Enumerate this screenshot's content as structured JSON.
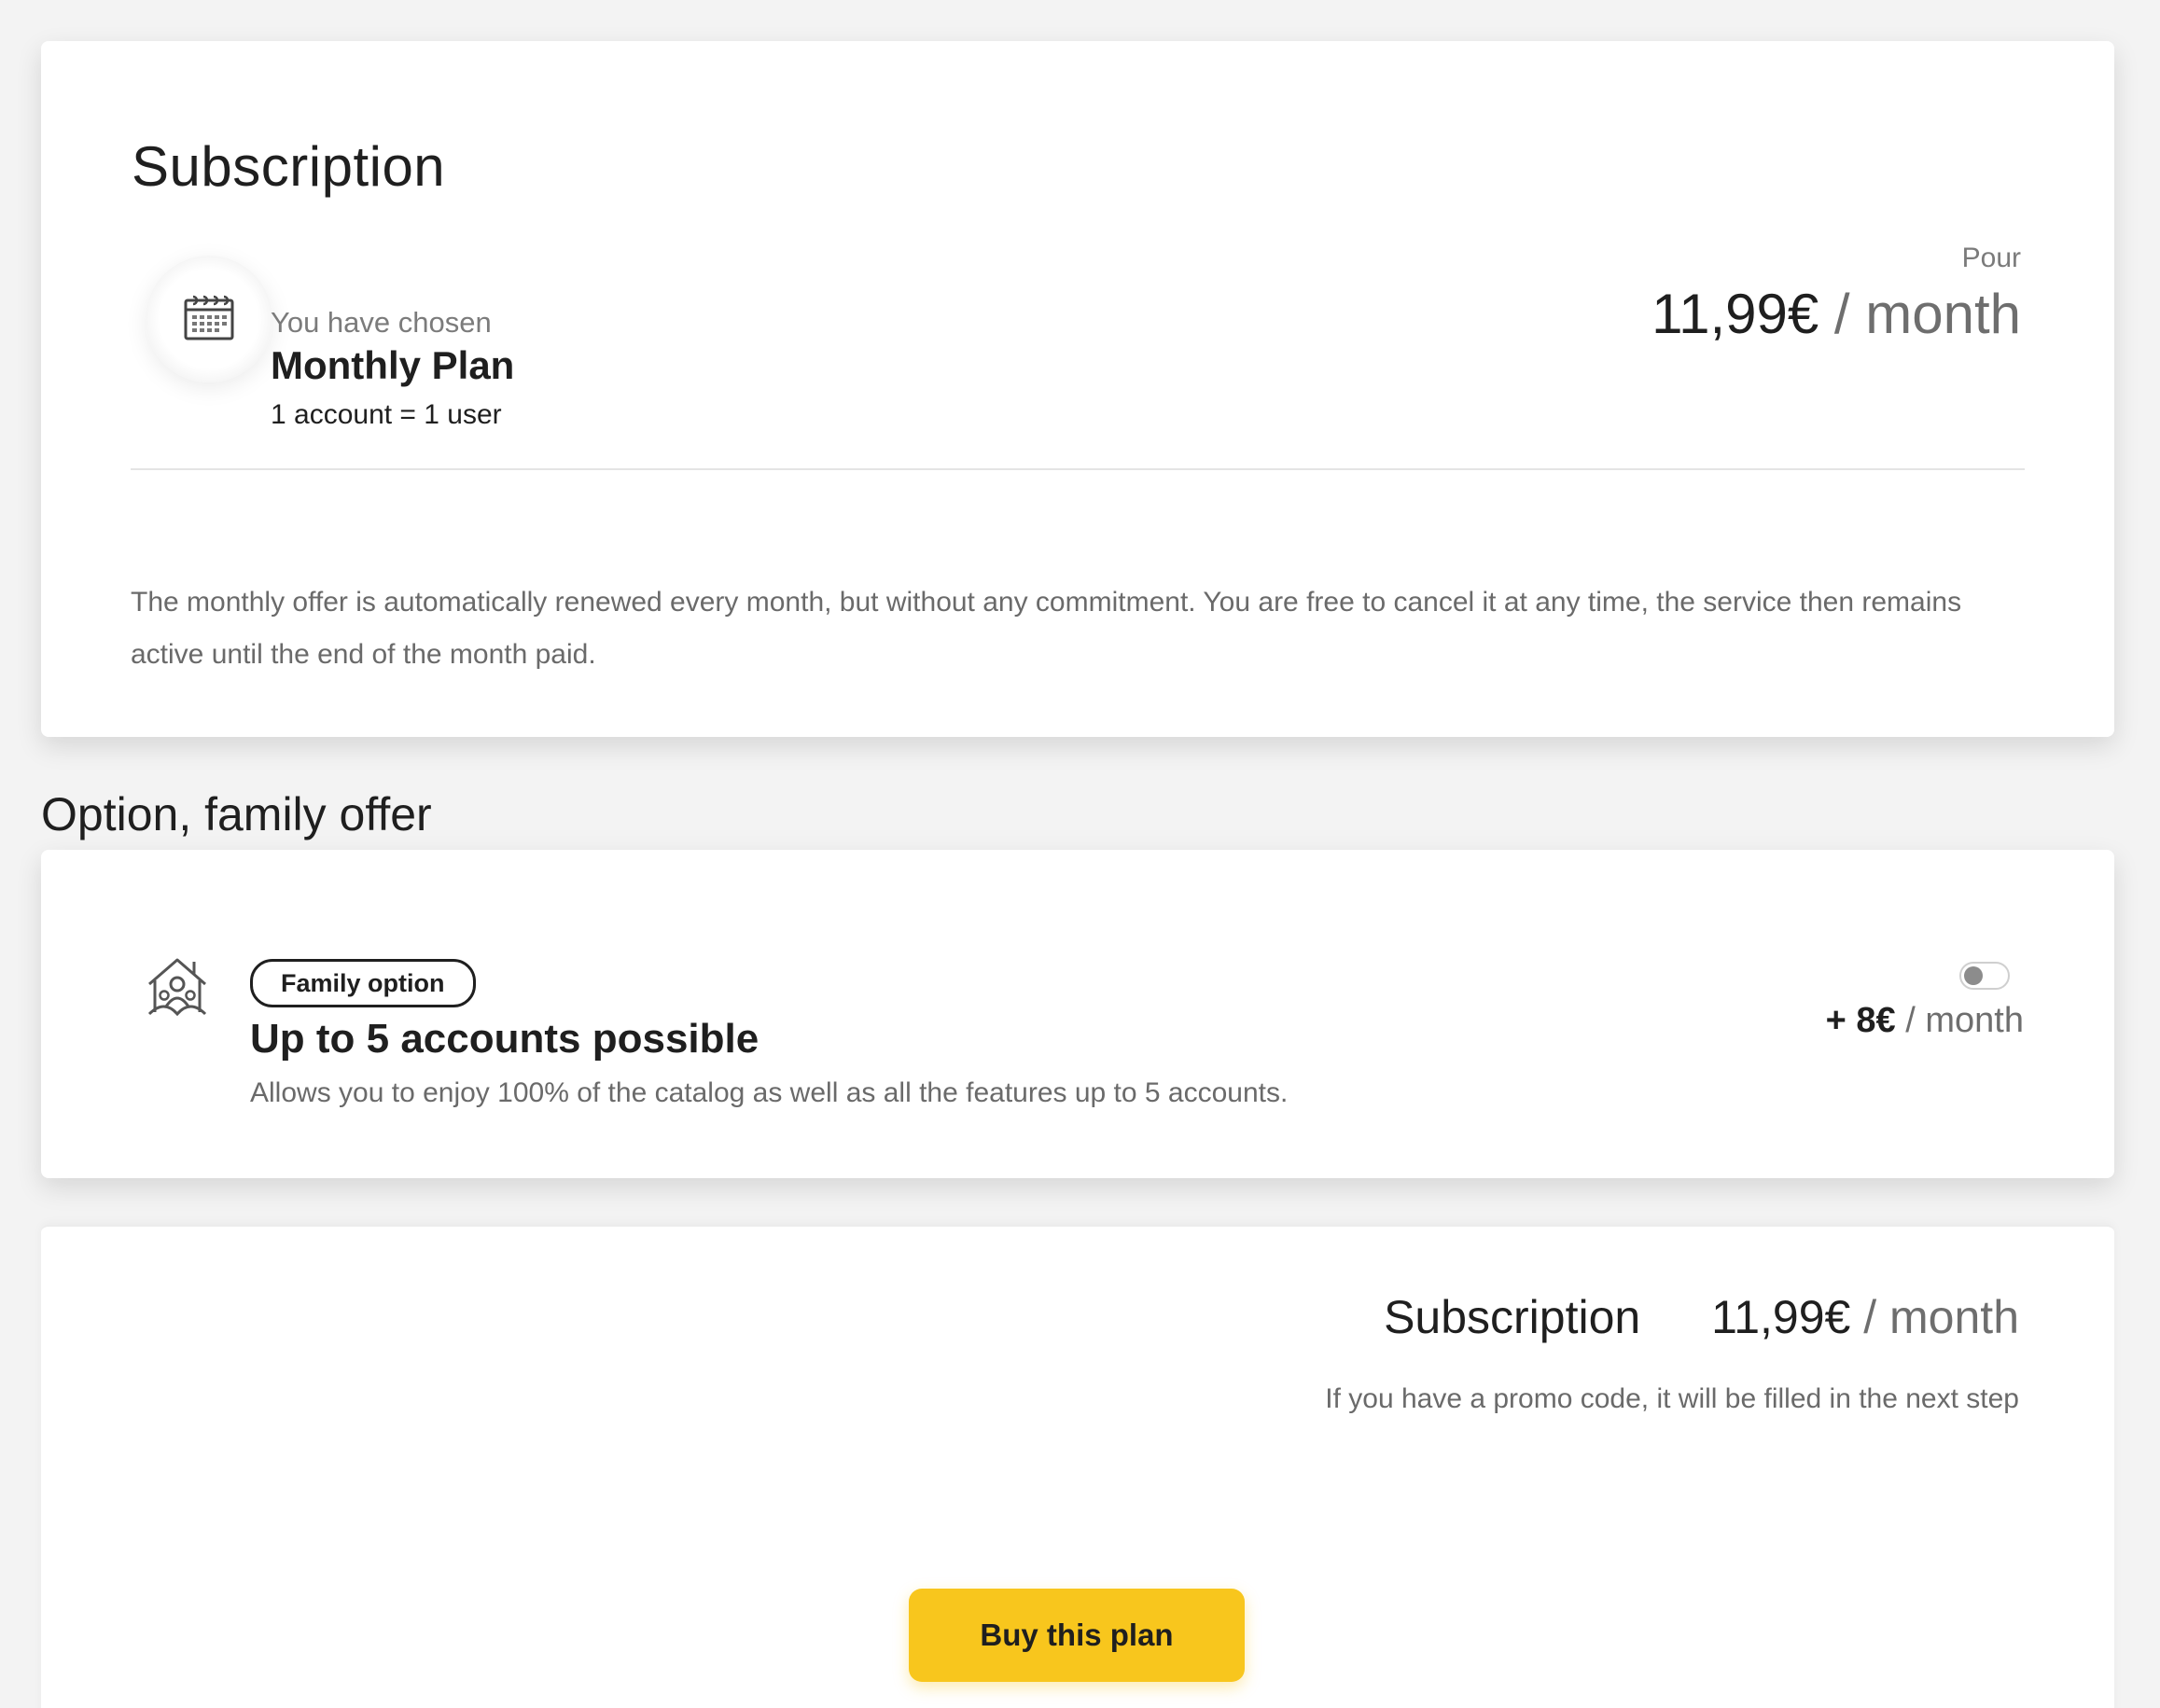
{
  "subscription": {
    "title": "Subscription",
    "chosen_label": "You have chosen",
    "plan_name": "Monthly Plan",
    "plan_note": "1 account = 1 user",
    "price_prefix": "Pour",
    "price": "11,99€",
    "price_period": "/ month",
    "description": "The monthly offer is automatically renewed every month, but without any commitment. You are free to cancel it at any time, the service then remains active until the end of the month paid."
  },
  "family_option": {
    "section_title": "Option, family offer",
    "badge": "Family option",
    "headline": "Up to 5 accounts possible",
    "description": "Allows you to enjoy 100% of the catalog as well as all the features up to 5 accounts.",
    "price": "+ 8€",
    "price_period": "/ month",
    "toggle_on": false
  },
  "summary": {
    "label": "Subscription",
    "price": "11,99€",
    "price_period": "/ month",
    "promo_note": "If you have a promo code, it will be filled in the next step",
    "buy_label": "Buy this plan"
  },
  "icons": {
    "plan": "calendar-icon",
    "family": "family-house-icon"
  },
  "colors": {
    "accent": "#f8c61d",
    "text": "#1f1f1f",
    "muted": "#6a6a6a",
    "background": "#f3f3f3"
  }
}
